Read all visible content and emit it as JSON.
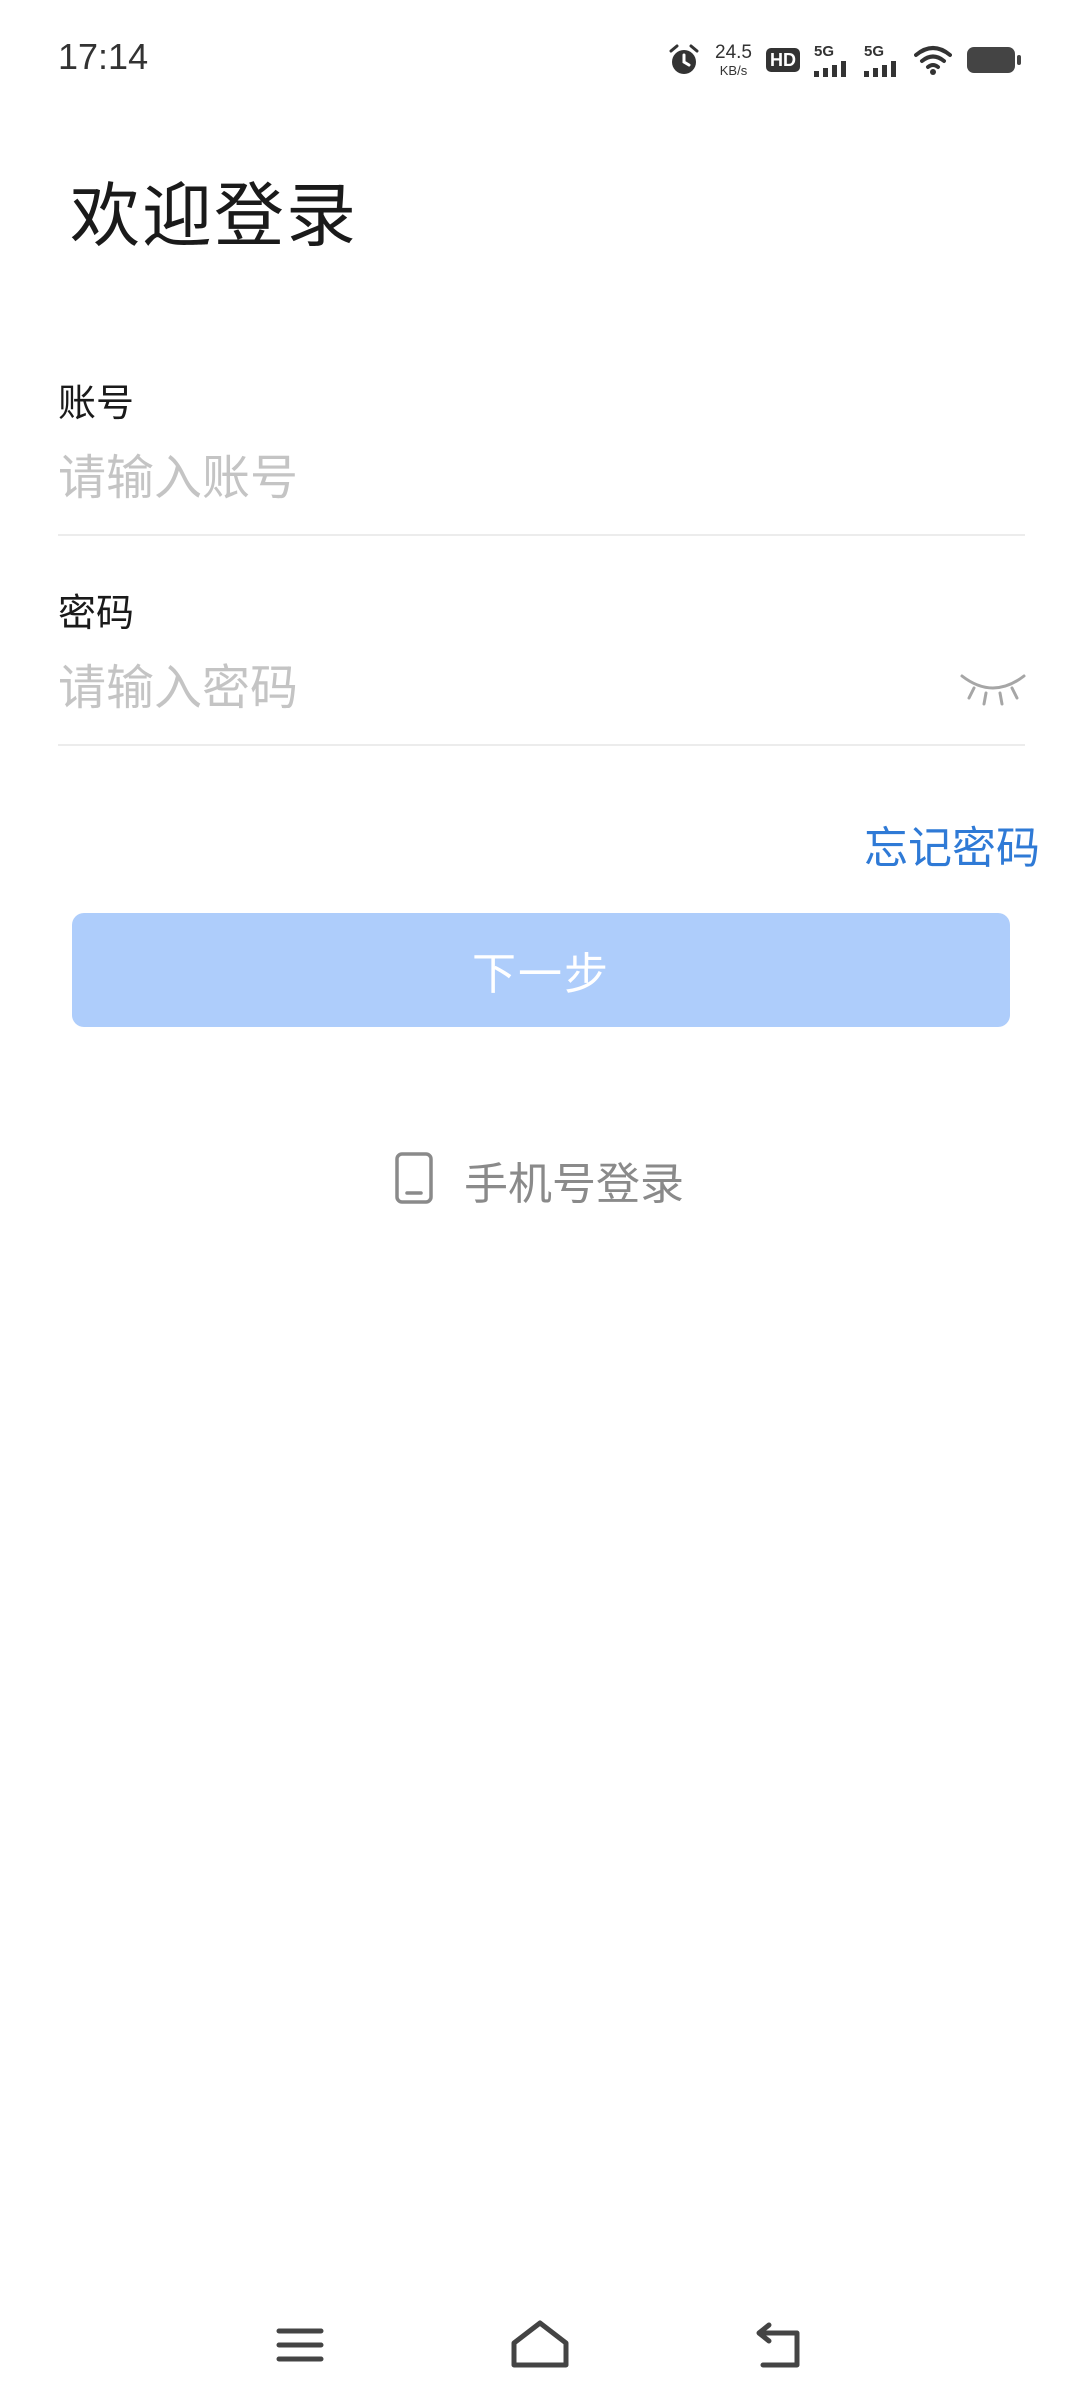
{
  "status_bar": {
    "time": "17:14",
    "net_speed_value": "24.5",
    "net_speed_unit": "KB/s",
    "hd_label": "HD",
    "signal_1_label": "5G",
    "signal_2_label": "5G",
    "icons": [
      "alarm-icon",
      "hd-icon",
      "signal-5g-icon",
      "signal-5g-icon",
      "wifi-icon",
      "battery-icon"
    ]
  },
  "page": {
    "title": "欢迎登录"
  },
  "account_field": {
    "label": "账号",
    "placeholder": "请输入账号",
    "value": ""
  },
  "password_field": {
    "label": "密码",
    "placeholder": "请输入密码",
    "value": "",
    "toggle_icon": "eye-closed-icon"
  },
  "forgot_password": {
    "label": "忘记密码"
  },
  "next_button": {
    "label": "下一步"
  },
  "phone_login": {
    "label": "手机号登录",
    "icon": "phone-icon"
  },
  "navigation_bar": {
    "buttons": [
      "menu-icon",
      "home-icon",
      "back-icon"
    ]
  },
  "colors": {
    "accent": "#2f7ad6",
    "button_disabled_bg": "#aecdfb",
    "placeholder": "#c4c4c4",
    "divider": "#ececec"
  }
}
